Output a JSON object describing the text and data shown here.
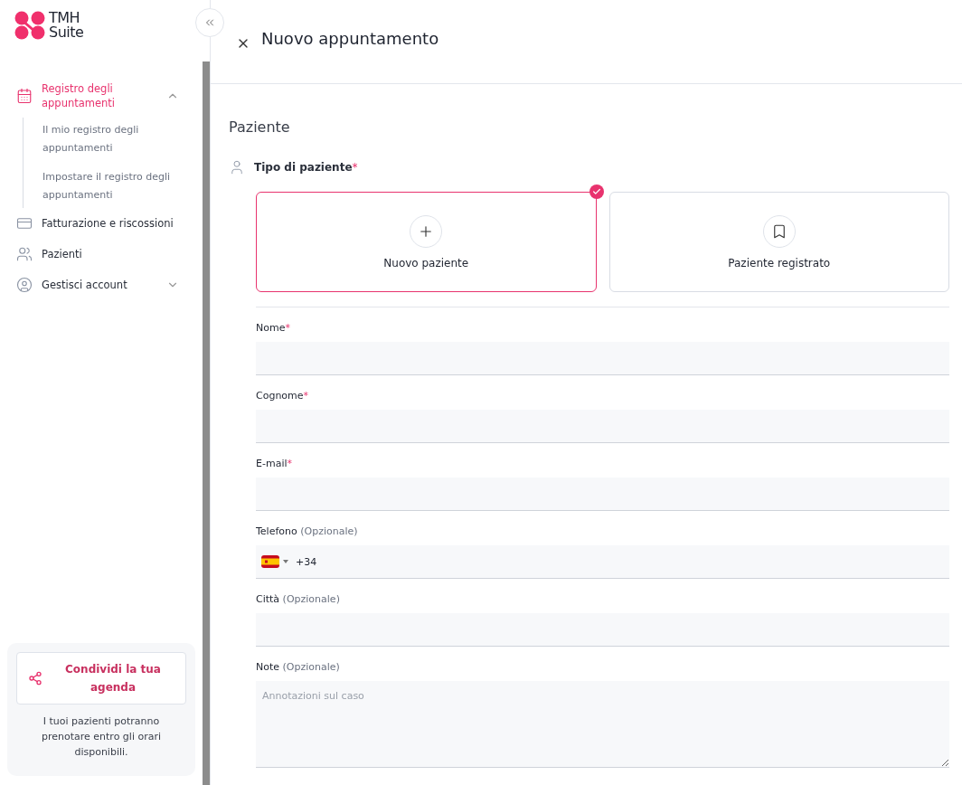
{
  "logo": {
    "line1": "TMH",
    "line2": "Suite"
  },
  "sidebar": {
    "items": [
      {
        "label": "Registro degli appuntamenti",
        "selected": true,
        "expanded": true,
        "children": [
          {
            "label": "Il mio registro degli appuntamenti"
          },
          {
            "label": "Impostare il registro degli appuntamenti"
          }
        ]
      },
      {
        "label": "Fatturazione e riscossioni",
        "selected": false
      },
      {
        "label": "Pazienti",
        "selected": false
      },
      {
        "label": "Gestisci account",
        "selected": false,
        "expanded": false
      }
    ],
    "share": {
      "button": "Condividi la tua agenda",
      "text": "I tuoi pazienti potranno prenotare entro gli orari disponibili."
    }
  },
  "header": {
    "title": "Nuovo appuntamento"
  },
  "section": "Paziente",
  "patient_type": {
    "label": "Tipo di paziente",
    "required": "*",
    "options": [
      {
        "label": "Nuovo paziente",
        "selected": true
      },
      {
        "label": "Paziente registrato",
        "selected": false
      }
    ]
  },
  "fields": [
    {
      "kind": "text",
      "label": "Nome",
      "required": "*"
    },
    {
      "kind": "text",
      "label": "Cognome",
      "required": "*"
    },
    {
      "kind": "text",
      "label": "E-mail",
      "required": "*"
    },
    {
      "kind": "phone",
      "label": "Telefono",
      "optional": "(Opzionale)",
      "value": "+34"
    },
    {
      "kind": "text",
      "label": "Città",
      "optional": "(Opzionale)"
    },
    {
      "kind": "textarea",
      "label": "Note",
      "optional": "(Opzionale)",
      "placeholder": "Annotazioni sul caso"
    }
  ]
}
